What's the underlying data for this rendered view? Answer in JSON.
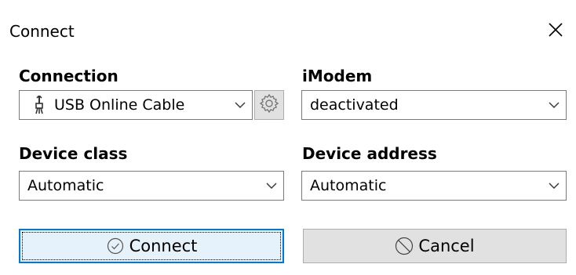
{
  "window": {
    "title": "Connect",
    "close_icon": "close-icon"
  },
  "connection": {
    "label": "Connection",
    "value": "USB Online Cable",
    "icon": "usb-plug-icon",
    "settings_icon": "gear-icon"
  },
  "imodem": {
    "label": "iModem",
    "value": "deactivated"
  },
  "device_class": {
    "label": "Device class",
    "value": "Automatic"
  },
  "device_address": {
    "label": "Device address",
    "value": "Automatic"
  },
  "buttons": {
    "connect_label": "Connect",
    "connect_icon": "check-circle-icon",
    "cancel_label": "Cancel",
    "cancel_icon": "prohibited-icon"
  },
  "colors": {
    "focus_border": "#0078d7",
    "button_bg": "#e1e1e1",
    "button_border": "#adadad",
    "combo_border": "#7a7a7a"
  }
}
